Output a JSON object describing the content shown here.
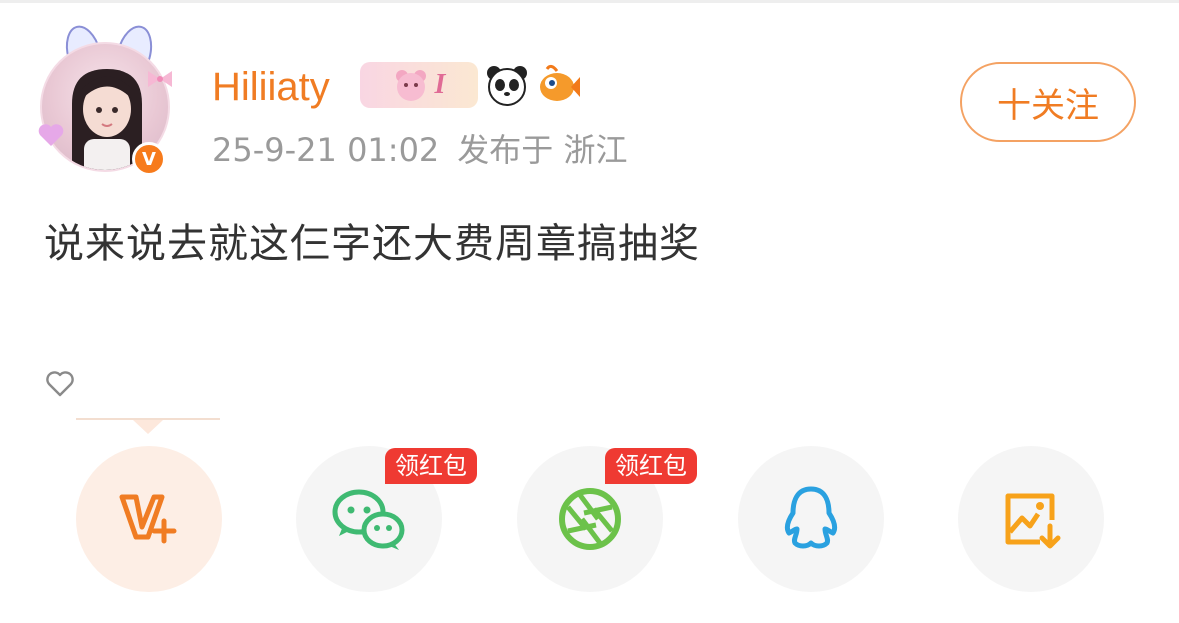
{
  "post": {
    "username": "Hiliiaty",
    "badge_text": "I",
    "timestamp": "25-9-21 01:02",
    "location": "发布于 浙江",
    "content": "说来说去就这仨字还大费周章搞抽奖"
  },
  "follow_button": {
    "label": "十关注"
  },
  "share_bar": {
    "items": [
      {
        "icon": "vplus-icon",
        "color": "#f07c23"
      },
      {
        "icon": "wechat-icon",
        "color": "#3fba72",
        "promo": "领红包"
      },
      {
        "icon": "moments-icon",
        "color": "#6cc24a",
        "promo": "领红包"
      },
      {
        "icon": "qq-icon",
        "color": "#2aa1e0"
      },
      {
        "icon": "save-image-icon",
        "color": "#f7a21a"
      }
    ]
  },
  "colors": {
    "accent": "#f07c23",
    "verified": "#f77b1c",
    "promo_red": "#ef3a32"
  }
}
